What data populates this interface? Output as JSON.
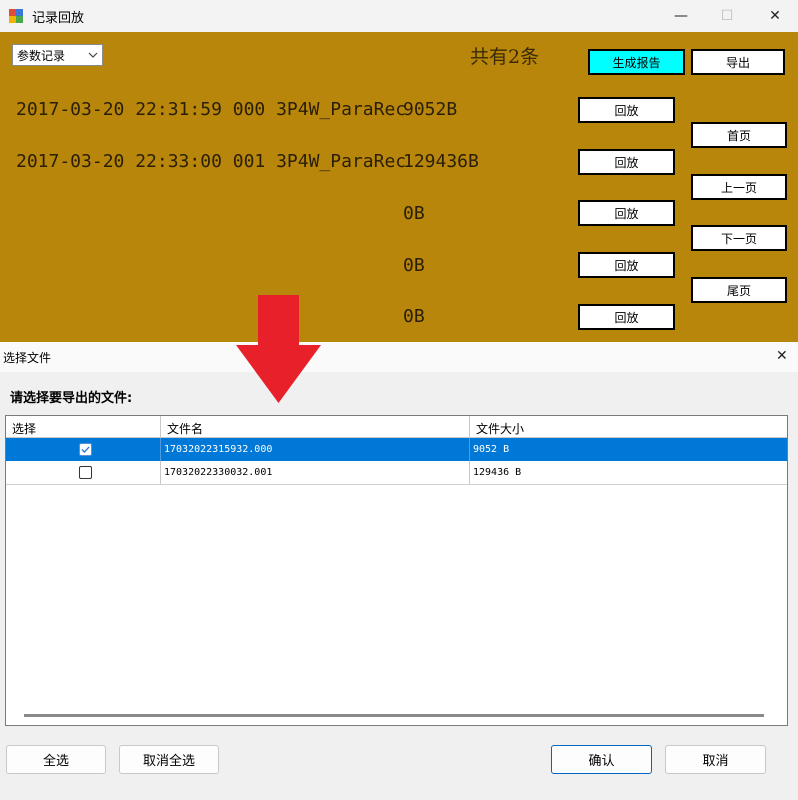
{
  "main_window": {
    "title": "记录回放",
    "controls": {
      "minimize": "—",
      "maximize": "☐",
      "close": "✕"
    },
    "type_select": {
      "value": "参数记录"
    },
    "count_text": "共有2条",
    "report_button": "生成报告",
    "export_button": "导出",
    "records": [
      {
        "text": "2017-03-20 22:31:59 000 3P4W_ParaRec",
        "size": "9052B"
      },
      {
        "text": "2017-03-20 22:33:00 001 3P4W_ParaRec",
        "size": "129436B"
      },
      {
        "text": "",
        "size": "0B"
      },
      {
        "text": "",
        "size": "0B"
      },
      {
        "text": "",
        "size": "0B"
      }
    ],
    "play_button": "回放",
    "nav": {
      "first": "首页",
      "prev": "上一页",
      "next": "下一页",
      "last": "尾页"
    },
    "colors": {
      "content_bg": "#b8860b",
      "report_button_bg": "#00ffff"
    }
  },
  "dialog": {
    "title": "选择文件",
    "close": "✕",
    "prompt": "请选择要导出的文件:",
    "columns": [
      "选择",
      "文件名",
      "文件大小"
    ],
    "rows": [
      {
        "checked": true,
        "filename": "17032022315932.000",
        "size": "9052 B"
      },
      {
        "checked": false,
        "filename": "17032022330032.001",
        "size": "129436 B"
      }
    ],
    "buttons": {
      "select_all": "全选",
      "deselect_all": "取消全选",
      "confirm": "确认",
      "cancel": "取消"
    },
    "colors": {
      "selected_row": "#0078d7"
    }
  },
  "annotation": {
    "arrow_color": "#e8202a",
    "arrow_icon": "down-arrow"
  }
}
